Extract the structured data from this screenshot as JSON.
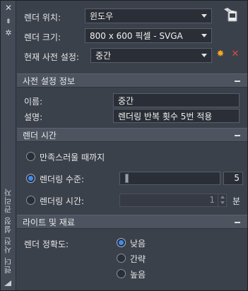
{
  "palette": {
    "panel_bg": "#3b414b",
    "strip_bg": "#444b56",
    "section_bg": "#4d5460",
    "input_bg": "#2a2e36",
    "accent_blue": "#3c8ef3",
    "new_icon_color": "#f5a623",
    "delete_icon_color": "#e04848"
  },
  "strip": {
    "close_icon": "close-icon",
    "pin_icon": "pin-icon",
    "settings_icon": "gear-icon",
    "vertical_title": "렌더 사전 설정 관리자"
  },
  "top": {
    "render_location_label": "렌더 위치:",
    "render_location_value": "윈도우",
    "render_size_label": "렌더 크기:",
    "render_size_value": "800 x 600 픽셀 - SVGA",
    "current_preset_label": "현재 사전 설정:",
    "current_preset_value": "중간",
    "render_icon": "render-teapot-icon",
    "new_preset_icon": "star-icon",
    "delete_preset_icon": "delete-icon"
  },
  "preset_info": {
    "title": "사전 설정 정보",
    "name_label": "이름:",
    "name_value": "중간",
    "description_label": "설명:",
    "description_value": "렌더링 반복 횟수 5번 적용"
  },
  "render_time": {
    "title": "렌더 시간",
    "options": [
      {
        "label": "만족스러울 때까지",
        "selected": false
      },
      {
        "label": "렌더링 수준:",
        "selected": true
      },
      {
        "label": "렌더링 시간:",
        "selected": false
      }
    ],
    "level_value": "5",
    "time_value": "1",
    "time_unit": "분"
  },
  "lights_materials": {
    "title": "라이트 및 재료",
    "accuracy_label": "렌더 정확도:",
    "options": [
      {
        "label": "낮음",
        "selected": true
      },
      {
        "label": "간략",
        "selected": false
      },
      {
        "label": "높음",
        "selected": false
      }
    ]
  }
}
